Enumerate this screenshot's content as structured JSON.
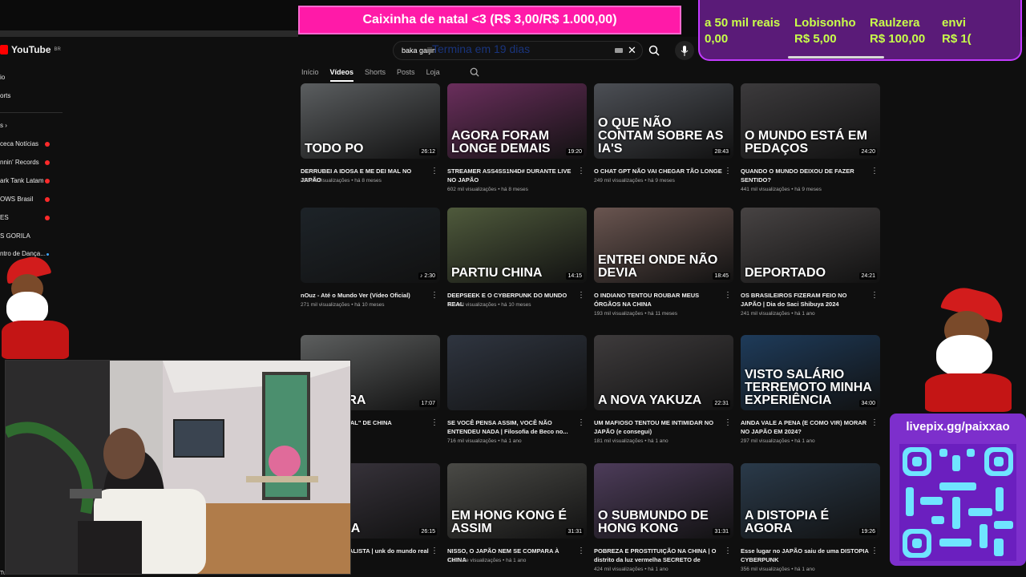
{
  "youtube": {
    "logo": "YouTube",
    "region": "BR",
    "search": {
      "query": "baka gaijin",
      "overlay_text": "Termina em 19 dias"
    },
    "sidebar": [
      {
        "label": "io",
        "live": false
      },
      {
        "label": "orts",
        "live": false
      },
      {
        "label": "s  ›",
        "live": false
      },
      {
        "label": "ceca Notícias",
        "live": true
      },
      {
        "label": "nnin' Records",
        "live": true
      },
      {
        "label": "ark Tank Latam",
        "live": true
      },
      {
        "label": "OWS Brasil",
        "live": true
      },
      {
        "label": "ES",
        "live": true
      },
      {
        "label": "S GORILA",
        "live": false
      },
      {
        "label": "ntro de Dança...",
        "live": false,
        "new": true
      }
    ],
    "bottom_left_text": "Tube Music",
    "tabs": [
      {
        "label": "Início",
        "active": false
      },
      {
        "label": "Vídeos",
        "active": true
      },
      {
        "label": "Shorts",
        "active": false
      },
      {
        "label": "Posts",
        "active": false
      },
      {
        "label": "Loja",
        "active": false
      }
    ],
    "videos": [
      {
        "thumb_text": "TODO PO",
        "duration": "26:12",
        "title": "DERRUBEI A IDOSA E ME DEI MAL NO JAPÃO",
        "meta": "225 mil visualizações • há 8 meses",
        "color": "#5b5e60"
      },
      {
        "thumb_text": "AGORA FORAM LONGE DEMAIS",
        "duration": "19:20",
        "title": "STREAMER ASS4SS1N4D# DURANTE LIVE NO JAPÃO",
        "meta": "602 mil visualizações • há 8 meses",
        "color": "#6a2e5c"
      },
      {
        "thumb_text": "O QUE NÃO CONTAM SOBRE AS IA'S",
        "duration": "28:43",
        "title": "O CHAT GPT NÃO VAI CHEGAR TÃO LONGE",
        "meta": "249 mil visualizações • há 9 meses",
        "color": "#4c4f55"
      },
      {
        "thumb_text": "O MUNDO ESTÁ EM PEDAÇOS",
        "duration": "24:20",
        "title": "QUANDO O MUNDO DEIXOU DE FAZER SENTIDO?",
        "meta": "441 mil visualizações • há 9 meses",
        "color": "#3c3a3c"
      },
      {
        "thumb_text": "",
        "duration": "♪ 2:30",
        "title": "nOuz - Até o Mundo Ver (Vídeo Oficial)",
        "meta": "271 mil visualizações • há 10 meses",
        "color": "#1d2328"
      },
      {
        "thumb_text": "PARTIU CHINA",
        "duration": "14:15",
        "title": "DEEPSEEK E O CYBERPUNK DO MUNDO REAL",
        "meta": "196 mil visualizações • há 10 meses",
        "color": "#4f5a3c"
      },
      {
        "thumb_text": "ENTREI ONDE NÃO DEVIA",
        "duration": "18:45",
        "title": "O INDIANO TENTOU ROUBAR MEUS ÓRGÃOS NA CHINA",
        "meta": "193 mil visualizações • há 11 meses",
        "color": "#6a5550"
      },
      {
        "thumb_text": "DEPORTADO",
        "duration": "24:21",
        "title": "OS BRASILEIROS FIZERAM FEIO NO JAPÃO | Dia do Saci Shibuya 2024",
        "meta": "241 mil visualizações • há 1 ano",
        "color": "#474343"
      },
      {
        "thumb_text": "AIS ERRA",
        "duration": "17:07",
        "title": "\"FAVELA VERTICAL\" DE CHINA",
        "meta": "• há 1 ano",
        "color": "#5d5f5f"
      },
      {
        "thumb_text": "",
        "duration": "",
        "title": "SE VOCÊ PENSA ASSIM, VOCÊ NÃO ENTENDEU NADA | Filosofia de Beco no...",
        "meta": "716 mil visualizações • há 1 ano",
        "color": "#2f3540"
      },
      {
        "thumb_text": "A NOVA YAKUZA",
        "duration": "22:31",
        "title": "UM MAFIOSO TENTOU ME INTIMIDAR NO JAPÃO (e consegui)",
        "meta": "181 mil visualizações • há 1 ano",
        "color": "#3e3b3c"
      },
      {
        "thumb_text": "VISTO SALÁRIO TERREMOTO MINHA EXPERIÊNCIA",
        "duration": "34:00",
        "title": "AINDA VALE A PENA (E COMO VIR) MORAR NO JAPÃO EM 2024?",
        "meta": "297 mil visualizações • há 1 ano",
        "color": "#1e3b5a"
      },
      {
        "thumb_text": "MOSTRA",
        "duration": "26:15",
        "title": "DA CHINA CAPITALISTA | unk do mundo real",
        "meta": "• há 1 ano",
        "color": "#3c3740"
      },
      {
        "thumb_text": "EM HONG KONG É ASSIM",
        "duration": "31:31",
        "title": "NISSO, O JAPÃO NEM SE COMPARA À CHINA",
        "meta": "1,1 mi de visualizações • há 1 ano",
        "color": "#4a4a46"
      },
      {
        "thumb_text": "O SUBMUNDO DE HONG KONG",
        "duration": "31:31",
        "title": "POBREZA E PROSTITUIÇÃO NA CHINA | O distrito da luz vermelha SECRETO de Hong...",
        "meta": "424 mil visualizações • há 1 ano",
        "color": "#4d3c5a"
      },
      {
        "thumb_text": "A DISTOPIA É AGORA",
        "duration": "19:26",
        "title": "Esse lugar no JAPÃO saiu de uma DISTOPIA CYBERPUNK",
        "meta": "356 mil visualizações • há 1 ano",
        "color": "#2a3a4a"
      }
    ]
  },
  "overlay": {
    "donation_banner": "Caixinha de natal <3 (R$ 3,00/R$ 1.000,00)",
    "ticker": [
      {
        "name": "a 50 mil reais",
        "amount": "0,00"
      },
      {
        "name": "Lobisonho",
        "amount": "R$ 5,00"
      },
      {
        "name": "Raulzera",
        "amount": "R$ 100,00"
      },
      {
        "name": "envi",
        "amount": "R$ 1("
      }
    ],
    "qr_label": "livepix.gg/paixxao"
  },
  "icons": {
    "search": "search-icon",
    "mic": "mic-icon",
    "clear": "close-icon",
    "keyboard": "keyboard-icon",
    "more": "more-vert-icon",
    "tab_search": "search-icon"
  },
  "colors": {
    "background": "#0f0f0f",
    "accent_red": "#ff0000",
    "donation_pink": "#ff1aa8",
    "ticker_purple": "#5a1b78",
    "ticker_text": "#c8ff4a",
    "qr_purple": "#7d2fcc"
  }
}
